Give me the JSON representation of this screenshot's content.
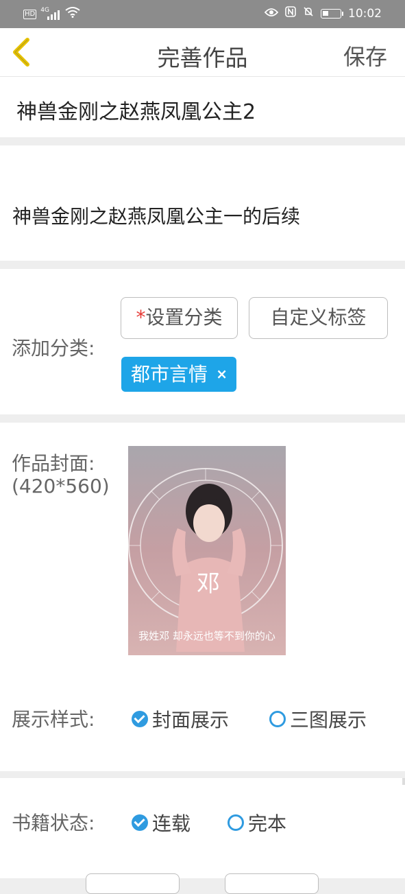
{
  "status_bar": {
    "hd_label": "HD",
    "network_label": "4G",
    "time": "10:02",
    "icons": [
      "signal-icon",
      "wifi-icon",
      "eye-icon",
      "nfc-icon",
      "mute-bell-icon",
      "battery-icon"
    ],
    "battery_level": 0.35
  },
  "navbar": {
    "title": "完善作品",
    "save_label": "保存",
    "back_icon": "chevron-left-icon",
    "back_color": "#e6c200"
  },
  "work": {
    "title": "神兽金刚之赵燕凤凰公主2",
    "description": "神兽金刚之赵燕凤凰公主一的后续"
  },
  "category": {
    "label": "添加分类:",
    "required_mark": "*",
    "set_category_label": "设置分类",
    "custom_tag_label": "自定义标签",
    "selected_tag": "都市言情",
    "remove_icon": "close-icon",
    "tag_color": "#1ea5e8"
  },
  "cover": {
    "label": "作品封面:",
    "size_hint": "(420*560)",
    "image_char": "邓",
    "image_caption": "我姓邓 却永远也等不到你的心"
  },
  "display_style": {
    "label": "展示样式:",
    "options": [
      {
        "label": "封面展示",
        "selected": true
      },
      {
        "label": "三图展示",
        "selected": false
      }
    ]
  },
  "book_status": {
    "label": "书籍状态:",
    "options": [
      {
        "label": "连载",
        "selected": true
      },
      {
        "label": "完本",
        "selected": false
      }
    ]
  },
  "accent_color": "#2f9be0"
}
